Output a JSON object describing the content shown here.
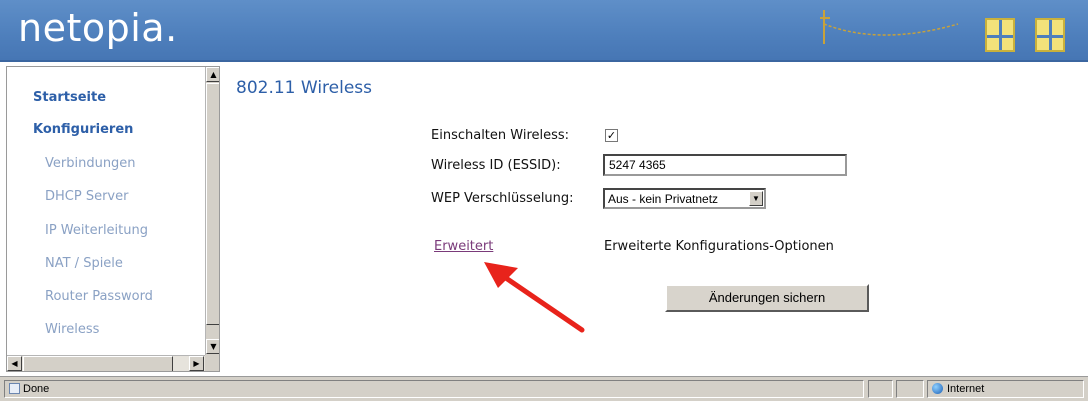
{
  "header": {
    "logo_text": "netopia."
  },
  "sidebar": {
    "items": [
      {
        "label": "Startseite",
        "level": "main"
      },
      {
        "label": "Konfigurieren",
        "level": "main"
      },
      {
        "label": "Verbindungen",
        "level": "sub"
      },
      {
        "label": "DHCP Server",
        "level": "sub"
      },
      {
        "label": "IP Weiterleitung",
        "level": "sub"
      },
      {
        "label": "NAT / Spiele",
        "level": "sub"
      },
      {
        "label": "Router Password",
        "level": "sub"
      },
      {
        "label": "Wireless",
        "level": "sub"
      }
    ]
  },
  "main": {
    "title": "802.11 Wireless",
    "form": {
      "enable_label": "Einschalten Wireless:",
      "enable_checked": "☑",
      "essid_label": "Wireless ID (ESSID):",
      "essid_value": "5247 4365",
      "wep_label": "WEP Verschlüsselung:",
      "wep_value": "Aus - kein Privatnetz"
    },
    "advanced": {
      "link_label": "Erweitert",
      "description": "Erweiterte Konfigurations-Optionen"
    },
    "save_button_label": "Änderungen sichern"
  },
  "statusbar": {
    "status_text": "Done",
    "zone_text": "Internet"
  },
  "colors": {
    "header_blue": "#4e7fbc",
    "title_blue": "#2d5fa8",
    "link_purple": "#7a3a7a",
    "arrow_red": "#e8231b"
  }
}
